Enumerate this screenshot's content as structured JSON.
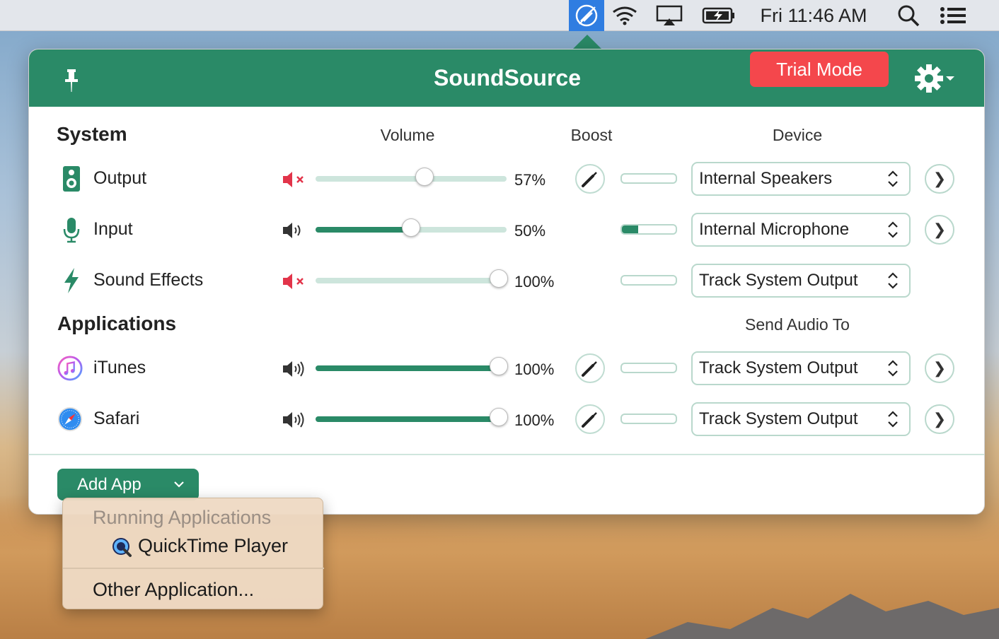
{
  "menubar": {
    "clock": "Fri 11:46 AM",
    "icons": [
      "soundsource-icon",
      "wifi-icon",
      "airplay-icon",
      "battery-charging-icon",
      "spotlight-search-icon",
      "notification-center-icon"
    ]
  },
  "header": {
    "title": "SoundSource",
    "trial_label": "Trial Mode",
    "color": "#2a8a67"
  },
  "columns": {
    "volume": "Volume",
    "boost": "Boost",
    "device": "Device",
    "send_audio_to": "Send Audio To"
  },
  "system": {
    "heading": "System",
    "rows": [
      {
        "label": "Output",
        "icon": "speaker-icon",
        "muted": true,
        "volume": 57,
        "volume_text": "57%",
        "device": "Internal Speakers",
        "meter_level": 0
      },
      {
        "label": "Input",
        "icon": "microphone-icon",
        "muted": false,
        "volume": 50,
        "volume_text": "50%",
        "device": "Internal Microphone",
        "meter_level": 0.3
      },
      {
        "label": "Sound Effects",
        "icon": "bolt-icon",
        "muted": true,
        "volume": 100,
        "volume_text": "100%",
        "device": "Track System Output",
        "meter_level": 0
      }
    ]
  },
  "applications": {
    "heading": "Applications",
    "rows": [
      {
        "label": "iTunes",
        "icon": "itunes-icon",
        "volume": 100,
        "volume_text": "100%",
        "device": "Track System Output",
        "meter_level": 0
      },
      {
        "label": "Safari",
        "icon": "safari-icon",
        "volume": 100,
        "volume_text": "100%",
        "device": "Track System Output",
        "meter_level": 0
      }
    ]
  },
  "add_app": {
    "label": "Add App",
    "menu": {
      "header": "Running Applications",
      "running": [
        "QuickTime Player"
      ],
      "other": "Other Application..."
    }
  }
}
